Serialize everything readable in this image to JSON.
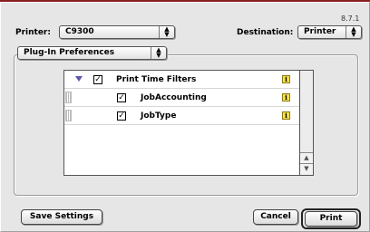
{
  "version": "8.7.1",
  "printer": {
    "label": "Printer:",
    "value": "C9300"
  },
  "destination": {
    "label": "Destination:",
    "value": "Printer"
  },
  "panel": {
    "value": "Plug-In Preferences"
  },
  "list": {
    "rows": [
      {
        "label": "Print Time Filters",
        "checked": true,
        "info": "i"
      },
      {
        "label": "JobAccounting",
        "checked": true,
        "info": "i"
      },
      {
        "label": "JobType",
        "checked": true,
        "info": "i"
      }
    ]
  },
  "buttons": {
    "save_settings": "Save Settings",
    "cancel": "Cancel",
    "print": "Print"
  },
  "glyphs": {
    "check": "✓",
    "up": "▲",
    "down": "▼",
    "popup_arrows": "⇕"
  }
}
